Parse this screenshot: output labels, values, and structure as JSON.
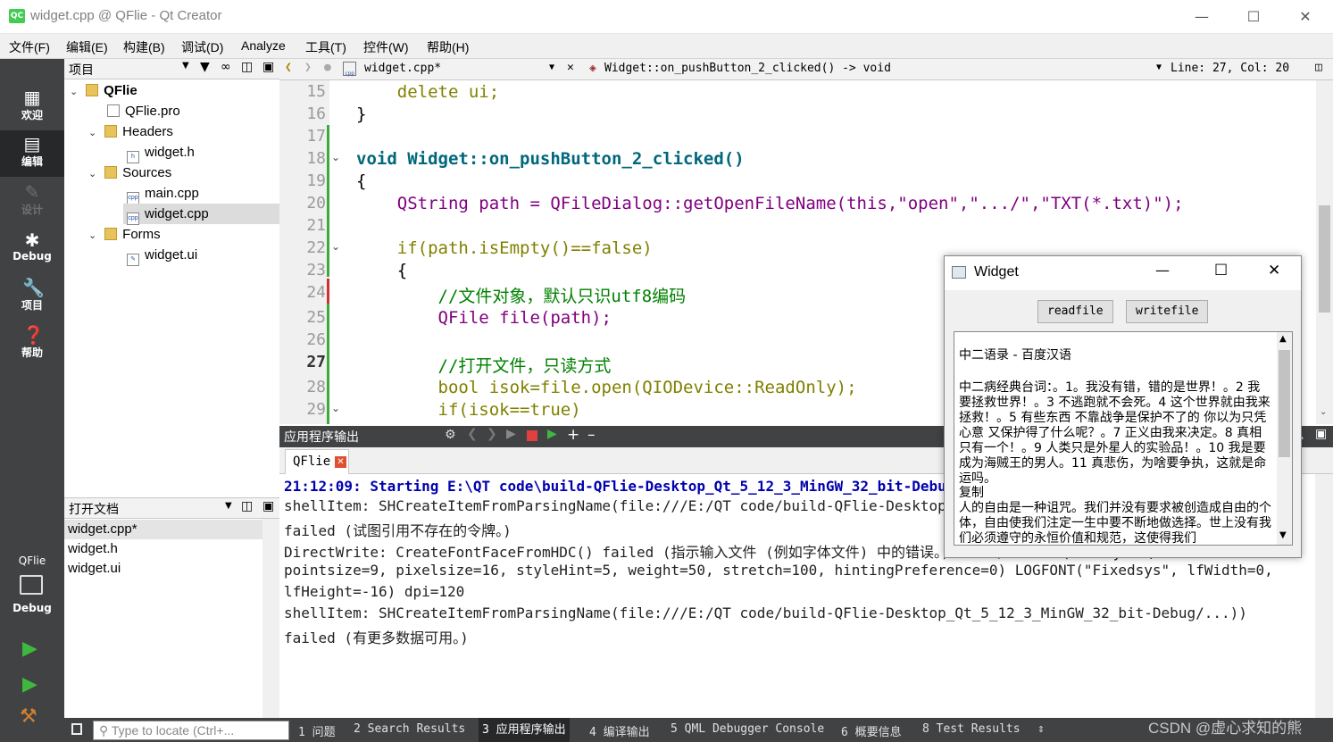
{
  "window": {
    "title": "widget.cpp @ QFlie - Qt Creator",
    "icon_text": "QC"
  },
  "menu": [
    "文件(F)",
    "编辑(E)",
    "构建(B)",
    "调试(D)",
    "Analyze",
    "工具(T)",
    "控件(W)",
    "帮助(H)"
  ],
  "modes": [
    {
      "label": "欢迎",
      "icon": "grid-icon"
    },
    {
      "label": "编辑",
      "icon": "edit-doc-icon"
    },
    {
      "label": "设计",
      "icon": "pen-icon"
    },
    {
      "label": "Debug",
      "icon": "bug-icon"
    },
    {
      "label": "项目",
      "icon": "wrench-icon"
    },
    {
      "label": "帮助",
      "icon": "help-icon"
    }
  ],
  "target": {
    "project": "QFlie",
    "config": "Debug"
  },
  "project_panel": {
    "title": "项目"
  },
  "tree": [
    {
      "label": "QFlie",
      "kind": "project"
    },
    {
      "label": "QFlie.pro",
      "kind": "pro"
    },
    {
      "label": "Headers",
      "kind": "folder"
    },
    {
      "label": "widget.h",
      "kind": "header"
    },
    {
      "label": "Sources",
      "kind": "folder"
    },
    {
      "label": "main.cpp",
      "kind": "cpp"
    },
    {
      "label": "widget.cpp",
      "kind": "cpp",
      "selected": true
    },
    {
      "label": "Forms",
      "kind": "folder"
    },
    {
      "label": "widget.ui",
      "kind": "ui"
    }
  ],
  "open_docs": {
    "title": "打开文档",
    "items": [
      "widget.cpp*",
      "widget.h",
      "widget.ui"
    ]
  },
  "editor": {
    "file": "widget.cpp*",
    "function": "Widget::on_pushButton_2_clicked() -> void",
    "position": "Line: 27, Col: 20",
    "line_numbers": [
      "15",
      "16",
      "17",
      "18",
      "19",
      "20",
      "21",
      "22",
      "23",
      "24",
      "25",
      "26",
      "27",
      "28",
      "29"
    ],
    "lines": [
      "    delete ui;",
      "}",
      "",
      "void Widget::on_pushButton_2_clicked()",
      "{",
      "    QString path = QFileDialog::getOpenFileName(this,\"open\",\".../\",\"TXT(*.txt)\");",
      "",
      "    if(path.isEmpty()==false)",
      "    {",
      "        //文件对象，默认只识utf8编码",
      "        QFile file(path);",
      "",
      "        //打开文件，只读方式",
      "        bool isok=file.open(QIODevice::ReadOnly);",
      "        if(isok==true)"
    ]
  },
  "output": {
    "title": "应用程序输出",
    "tab": "QFlie",
    "lines": [
      "21:12:09: Starting E:\\QT code\\build-QFlie-Desktop_Qt_5_12_3_MinGW_32_bit-Debug\\debug\\QFlie.exe...",
      "shellItem: SHCreateItemFromParsingName(file:///E:/QT code/build-QFlie-Desktop_Qt_5_12_3_MinGW_32_bit-Debug/...))",
      "failed (试图引用不存在的令牌。)",
      "DirectWrite: CreateFontFaceFromHDC() failed (指示输入文件 (例如字体文件) 中的错误。) for QFontDef(Family=\"\",",
      "pointsize=9, pixelsize=16, styleHint=5, weight=50, stretch=100, hintingPreference=0) LOGFONT(\"Fixedsys\", lfWidth=0,",
      "lfHeight=-16) dpi=120",
      "shellItem: SHCreateItemFromParsingName(file:///E:/QT code/build-QFlie-Desktop_Qt_5_12_3_MinGW_32_bit-Debug/...))",
      "failed (有更多数据可用。)"
    ]
  },
  "statusbar": {
    "locator_placeholder": "Type to locate (Ctrl+...",
    "tabs": [
      "1 问题",
      "2 Search Results",
      "3 应用程序输出",
      "4 编译输出",
      "5 QML Debugger Console",
      "6 概要信息",
      "8 Test Results"
    ]
  },
  "watermark": "CSDN @虚心求知的熊",
  "widget": {
    "title": "Widget",
    "buttons": [
      "readfile",
      "writefile"
    ],
    "text": [
      "",
      "中二语录 - 百度汉语",
      "",
      "中二病经典台词：。1。我没有错，错的是世界！。2 我要拯救世界！。3 不逃跑就不会死。4 这个世界就由我来拯救！。5 有些东西 不靠战争是保护不了的 你以为只凭心意 又保护得了什么呢？。7 正义由我来决定。8 真相只有一个！。9 人类只是外星人的实验品！。10 我是要成为海贼王的男人。11 真悲伤，为啥要争执，这就是命运吗。",
      "复制",
      "人的自由是一种诅咒。我们并没有要求被创造成自由的个体，自由使我们注定一生中要不断地做选择。世上没有我们必须遵守的永恒价值和规范，这使得我们"
    ]
  }
}
